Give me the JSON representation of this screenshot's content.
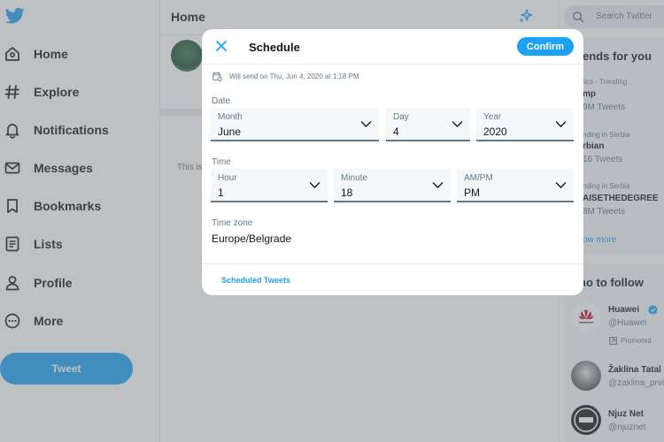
{
  "sidebar": {
    "items": [
      {
        "label": "Home",
        "icon": "home-icon"
      },
      {
        "label": "Explore",
        "icon": "hashtag-icon"
      },
      {
        "label": "Notifications",
        "icon": "bell-icon"
      },
      {
        "label": "Messages",
        "icon": "mail-icon"
      },
      {
        "label": "Bookmarks",
        "icon": "bookmark-icon"
      },
      {
        "label": "Lists",
        "icon": "list-icon"
      },
      {
        "label": "Profile",
        "icon": "user-icon"
      },
      {
        "label": "More",
        "icon": "more-icon"
      }
    ],
    "tweet_button": "Tweet"
  },
  "main": {
    "title": "Home",
    "partial_text": "This is"
  },
  "right": {
    "search_placeholder": "Search Twitter",
    "trends_title": "ends for you",
    "trends": [
      {
        "meta": "tics · Trending",
        "name": "mp",
        "count": "9M Tweets"
      },
      {
        "meta": "nding in Serbia",
        "name": "rbian",
        "count": "16 Tweets"
      },
      {
        "meta": "nding in Serbia",
        "name": "AISETHEDEGREE",
        "count": "8M Tweets"
      }
    ],
    "show_more": "ow more",
    "follow_title": "ho to follow",
    "follow": [
      {
        "name": "Huawei",
        "handle": "@Huawei",
        "promoted": "Promoted"
      },
      {
        "name": "Žaklina Tatal",
        "handle": "@zaklina_prvi"
      },
      {
        "name": "Njuz Net",
        "handle": "@njuznet"
      }
    ]
  },
  "modal": {
    "title": "Schedule",
    "confirm": "Confirm",
    "will_send": "Will send on Thu, Jun 4, 2020 at 1:18 PM",
    "date_label": "Date",
    "month": {
      "label": "Month",
      "value": "June"
    },
    "day": {
      "label": "Day",
      "value": "4"
    },
    "year": {
      "label": "Year",
      "value": "2020"
    },
    "time_label": "Time",
    "hour": {
      "label": "Hour",
      "value": "1"
    },
    "minute": {
      "label": "Minute",
      "value": "18"
    },
    "ampm": {
      "label": "AM/PM",
      "value": "PM"
    },
    "timezone_label": "Time zone",
    "timezone_value": "Europe/Belgrade",
    "scheduled_tweets": "Scheduled Tweets"
  },
  "colors": {
    "accent": "#1da1f2",
    "text": "#14171a",
    "secondary": "#657786",
    "overlay": "rgba(110,118,125,0.45)"
  }
}
